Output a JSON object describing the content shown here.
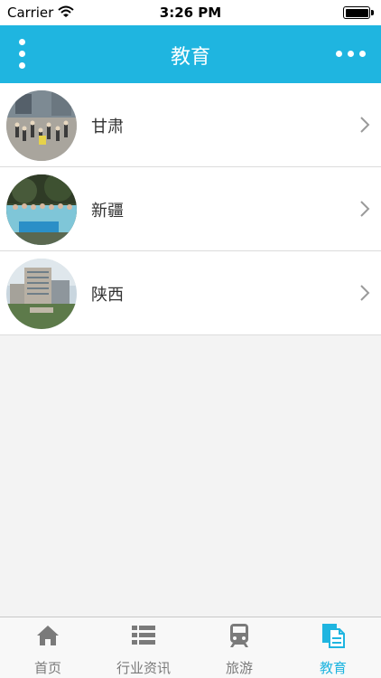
{
  "status_bar": {
    "carrier": "Carrier",
    "time": "3:26 PM"
  },
  "nav": {
    "title": "教育"
  },
  "list": {
    "items": [
      {
        "label": "甘肃",
        "thumb_icon": "group-photo-stairs"
      },
      {
        "label": "新疆",
        "thumb_icon": "group-photo-banner"
      },
      {
        "label": "陕西",
        "thumb_icon": "building-photo"
      }
    ]
  },
  "tabs": [
    {
      "label": "首页",
      "icon": "home-icon",
      "active": false
    },
    {
      "label": "行业资讯",
      "icon": "list-icon",
      "active": false
    },
    {
      "label": "旅游",
      "icon": "train-icon",
      "active": false
    },
    {
      "label": "教育",
      "icon": "document-icon",
      "active": true
    }
  ],
  "colors": {
    "accent": "#1fb5e0",
    "inactive": "#7a7a7a",
    "background": "#f3f3f3"
  }
}
